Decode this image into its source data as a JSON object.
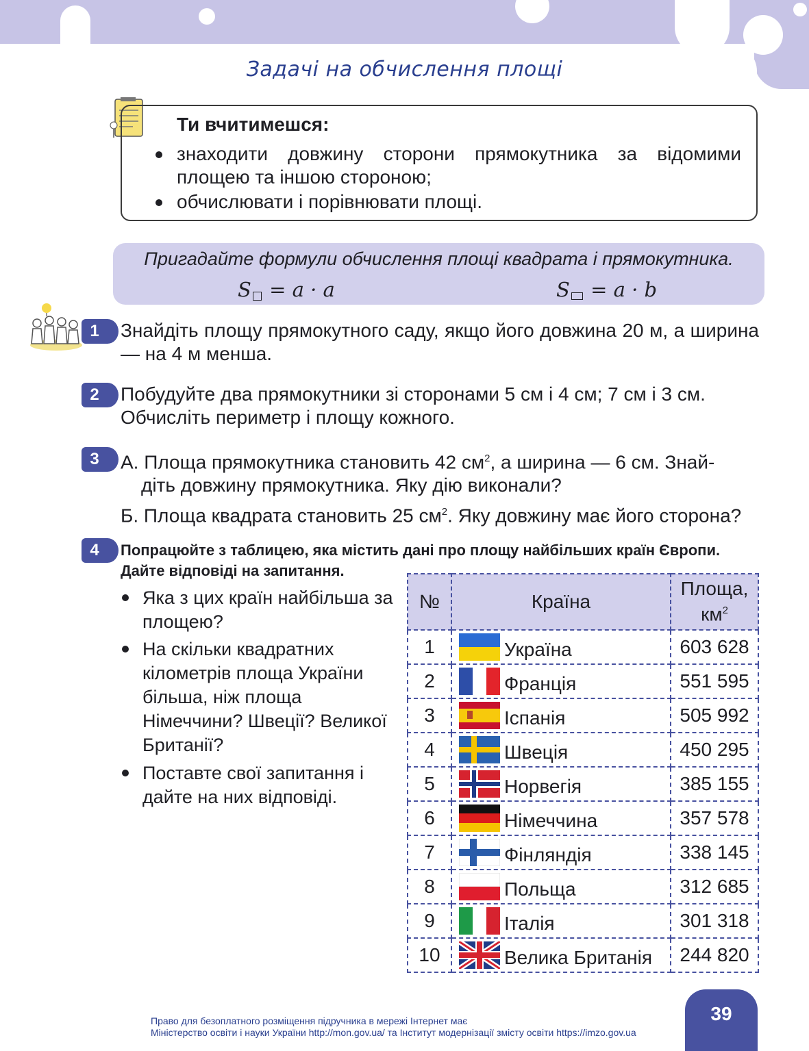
{
  "header": {
    "title": "Задачі на обчислення площі"
  },
  "learn": {
    "heading": "Ти вчитимешся:",
    "items": [
      "знаходити довжину сторони прямокутника за відомими площею та іншою стороною;",
      "обчислювати і порівнювати площі."
    ]
  },
  "formula": {
    "prompt": "Пригадайте формули обчислення площі квадрата і прямокутника.",
    "square_lhs": "S",
    "square_rhs": "= a · a",
    "rect_lhs": "S",
    "rect_rhs": "= a · b"
  },
  "tasks": [
    {
      "num": "1",
      "text": "Знайдіть площу прямокутного саду, якщо його довжина 20 м, а ширина — на 4 м менша."
    },
    {
      "num": "2",
      "line1": "Побудуйте два прямокутники зі сторонами 5 см і 4 см; 7 см і 3 см.",
      "line2": "Обчисліть периметр і площу кожного."
    },
    {
      "num": "3",
      "a_prefix": "А. Площа прямокутника становить 42 см",
      "a_sup": "2",
      "a_suffix": ", а ширина — 6 см. Знай-",
      "a_line2": "діть довжину прямокутника. Яку дію виконали?",
      "b_prefix": "Б. Площа квадрата становить 25 см",
      "b_sup": "2",
      "b_suffix": ". Яку довжину має його сторона?"
    },
    {
      "num": "4",
      "text": "Попрацюйте з таблицею, яка містить дані про площу найбільших країн Європи. Дайте відповіді на запитання."
    }
  ],
  "questions": [
    "Яка з цих країн найбільша за площею?",
    "На скільки квадратних кілометрів площа України більша, ніж площа Німеччини? Швеції? Великої Британії?",
    "Поставте свої запитання і дайте на них відповіді."
  ],
  "table": {
    "headers": {
      "num": "№",
      "country": "Країна",
      "area": "Площа,",
      "unit": "км",
      "unit_sup": "2"
    },
    "rows": [
      {
        "n": "1",
        "country": "Україна",
        "area": "603 628",
        "flag": "flag-ukraine"
      },
      {
        "n": "2",
        "country": "Франція",
        "area": "551 595",
        "flag": "flag-france"
      },
      {
        "n": "3",
        "country": "Іспанія",
        "area": "505 992",
        "flag": "flag-spain"
      },
      {
        "n": "4",
        "country": "Швеція",
        "area": "450 295",
        "flag": "flag-sweden"
      },
      {
        "n": "5",
        "country": "Норвегія",
        "area": "385 155",
        "flag": "flag-norway"
      },
      {
        "n": "6",
        "country": "Німеччина",
        "area": "357 578",
        "flag": "flag-germany"
      },
      {
        "n": "7",
        "country": "Фінляндія",
        "area": "338 145",
        "flag": "flag-finland"
      },
      {
        "n": "8",
        "country": "Польща",
        "area": "312 685",
        "flag": "flag-poland"
      },
      {
        "n": "9",
        "country": "Італія",
        "area": "301 318",
        "flag": "flag-italy"
      },
      {
        "n": "10",
        "country": "Велика Британія",
        "area": "244 820",
        "flag": "flag-uk"
      }
    ]
  },
  "footer": {
    "line1": "Право для безоплатного розміщення підручника в мережі Інтернет має",
    "line2": "Міністерство освіти і науки України http://mon.gov.ua/ та Інститут модернізації змісту освіти https://imzo.gov.ua",
    "page": "39"
  },
  "colors": {
    "accent": "#4852a0",
    "band": "#c7c4e6",
    "formula_bg": "#d2d0ec",
    "title": "#2a3f8f"
  }
}
